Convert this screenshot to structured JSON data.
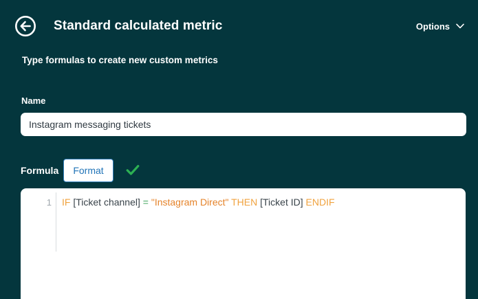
{
  "colors": {
    "background": "#04363D",
    "accent_blue": "#1F73B7",
    "success_green": "#2DB153",
    "keyword": "#F0A23E",
    "string": "#E5832A",
    "operator": "#3FA45B",
    "field": "#39434A",
    "line_number": "#9EA6AC"
  },
  "header": {
    "back_icon": "arrow-left-circle",
    "title": "Standard calculated metric",
    "options_label": "Options",
    "options_icon": "chevron-down"
  },
  "subheader": "Type formulas to create new custom metrics",
  "name_section": {
    "label": "Name",
    "value": "Instagram messaging tickets"
  },
  "formula_section": {
    "label": "Formula",
    "format_button": "Format",
    "valid_icon": "check"
  },
  "editor": {
    "line_number": "1",
    "formula_text": "IF [Ticket channel] = \"Instagram Direct\" THEN [Ticket ID] ENDIF",
    "tokens": [
      {
        "text": "IF",
        "type": "keyword"
      },
      {
        "text": " [Ticket channel] ",
        "type": "field"
      },
      {
        "text": "=",
        "type": "operator"
      },
      {
        "text": " ",
        "type": "field"
      },
      {
        "text": "\"Instagram Direct\"",
        "type": "string"
      },
      {
        "text": " ",
        "type": "field"
      },
      {
        "text": "THEN",
        "type": "keyword"
      },
      {
        "text": " [Ticket ID] ",
        "type": "field"
      },
      {
        "text": "ENDIF",
        "type": "keyword"
      }
    ]
  }
}
